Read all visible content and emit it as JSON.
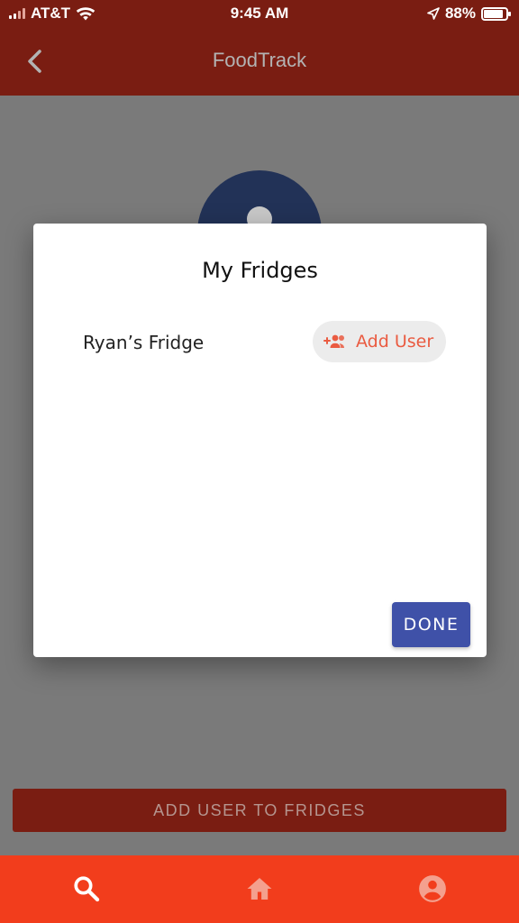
{
  "status_bar": {
    "carrier": "AT&T",
    "time": "9:45 AM",
    "battery": "88%",
    "battery_level": 0.88,
    "icons": [
      "signal-icon",
      "wifi-icon",
      "location-arrow-icon",
      "battery-icon"
    ]
  },
  "app_bar": {
    "title": "FoodTrack",
    "back_icon": "chevron-left-icon"
  },
  "background": {
    "add_user_to_fridges_label": "ADD USER TO FRIDGES",
    "avatar_icon": "account-circle-icon"
  },
  "dialog": {
    "title": "My Fridges",
    "fridges": [
      {
        "name": "Ryan’s Fridge",
        "action_label": "Add User",
        "action_icon": "group-add-icon"
      }
    ],
    "done_label": "DONE"
  },
  "bottom_nav": {
    "items": [
      {
        "name": "search",
        "icon": "search-icon"
      },
      {
        "name": "home",
        "icon": "home-icon"
      },
      {
        "name": "account",
        "icon": "account-circle-icon"
      }
    ]
  },
  "colors": {
    "app_bar": "#7a1d12",
    "bottom_nav": "#f23d1c",
    "scrim": "#7a7a7a",
    "dialog_accent": "#ea5b41",
    "done_button": "#3f51a8",
    "avatar": "#223257"
  }
}
